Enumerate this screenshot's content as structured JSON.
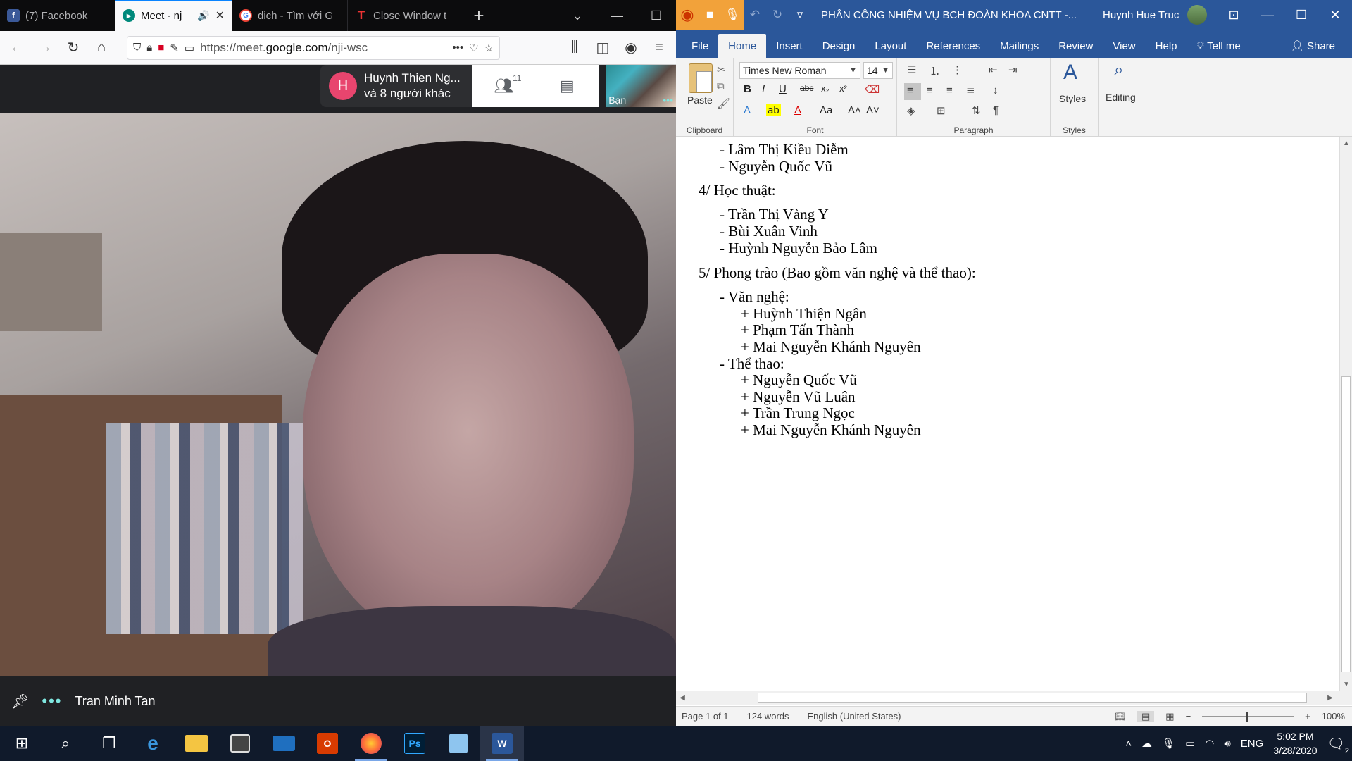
{
  "firefox": {
    "tabs": [
      {
        "label": "(7) Facebook",
        "icon": "facebook-icon"
      },
      {
        "label": "Meet - nj",
        "icon": "meet-icon",
        "active": true
      },
      {
        "label": "dich - Tìm với G",
        "icon": "google-icon"
      },
      {
        "label": "Close Window t",
        "icon": "t-icon"
      }
    ],
    "url": {
      "prefix": "https://meet.",
      "host": "google.com",
      "path": "/nji-wsc"
    }
  },
  "meet": {
    "participants_name": "Huynh Thien Ng...",
    "participants_more": "và 8 người khác",
    "avatar_letter": "H",
    "people_count": "11",
    "self_label": "Bạn",
    "speaker_name": "Tran Minh Tan"
  },
  "word": {
    "title": "PHÂN CÔNG NHIỆM VỤ BCH ĐOÀN KHOA CNTT -...",
    "user": "Huynh Hue Truc",
    "tabs": [
      "File",
      "Home",
      "Insert",
      "Design",
      "Layout",
      "References",
      "Mailings",
      "Review",
      "View",
      "Help"
    ],
    "tell_me": "Tell me",
    "share": "Share",
    "ribbon": {
      "paste": "Paste",
      "font_name": "Times New Roman",
      "font_size": "14",
      "styles": "Styles",
      "editing": "Editing",
      "groups": {
        "clipboard": "Clipboard",
        "font": "Font",
        "paragraph": "Paragraph",
        "styles": "Styles"
      }
    },
    "document": {
      "lines": [
        "-    Lâm Thị Kiều Diễm",
        "-    Nguyễn Quốc Vũ",
        "4/ Học thuật:",
        "-    Trần Thị Vàng Y",
        "-    Bùi Xuân Vinh",
        "-    Huỳnh Nguyễn Bảo Lâm",
        "5/ Phong trào (Bao gồm văn nghệ và thể thao):",
        "-     Văn nghệ:",
        "+ Huỳnh Thiện Ngân",
        "+ Phạm Tấn Thành",
        "+ Mai Nguyễn Khánh Nguyên",
        "-    Thể thao:",
        "+ Nguyễn Quốc Vũ",
        "+ Nguyễn Vũ Luân",
        "+ Trần Trung Ngọc",
        "+ Mai Nguyễn Khánh Nguyên"
      ]
    },
    "status": {
      "page": "Page 1 of 1",
      "words": "124 words",
      "language": "English (United States)",
      "zoom": "100%"
    }
  },
  "taskbar": {
    "tray_lang": "ENG",
    "time": "5:02 PM",
    "date": "3/28/2020",
    "notif_count": "2"
  }
}
